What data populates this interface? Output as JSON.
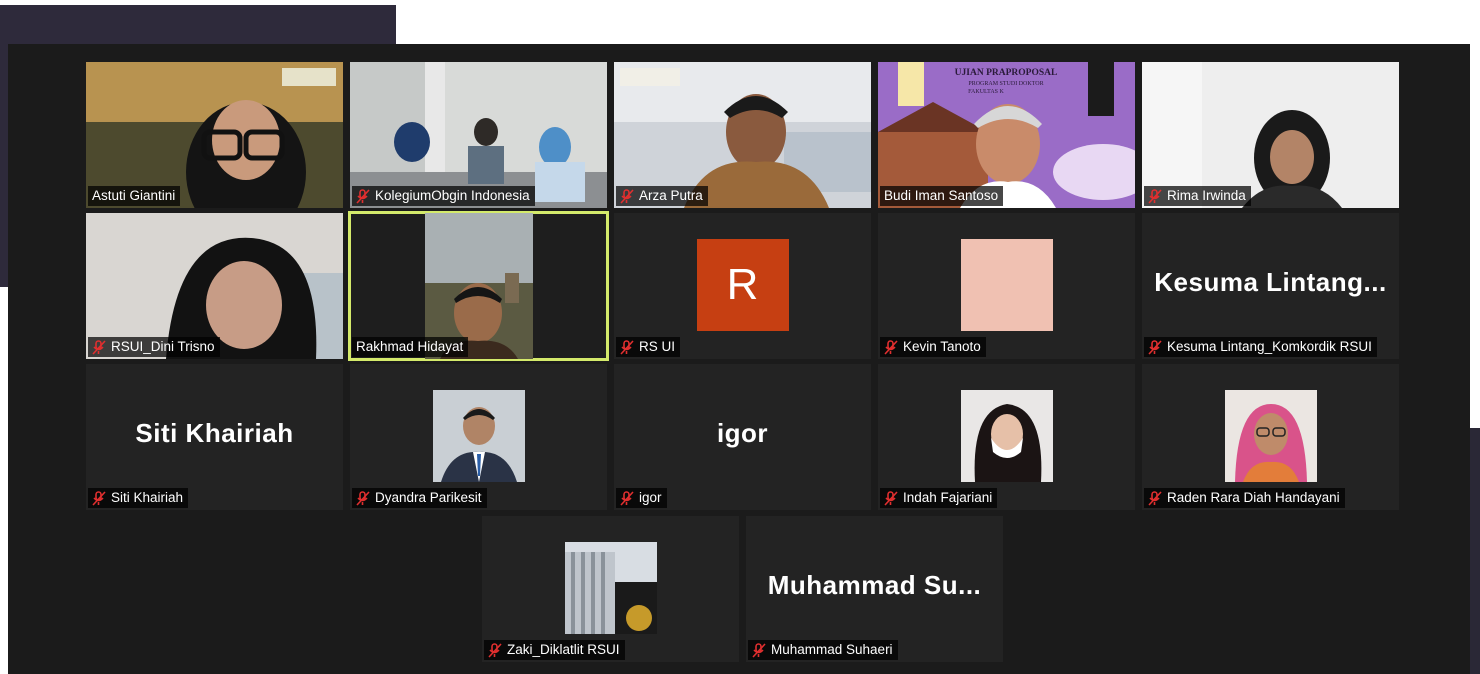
{
  "meeting": {
    "participants": [
      {
        "name": "Astuti Giantini",
        "muted": false,
        "type": "video"
      },
      {
        "name": "KolegiumObgin Indonesia",
        "muted": true,
        "type": "video"
      },
      {
        "name": "Arza Putra",
        "muted": true,
        "type": "video"
      },
      {
        "name": "Budi Iman Santoso",
        "muted": false,
        "type": "video"
      },
      {
        "name": "Rima Irwinda",
        "muted": true,
        "type": "video"
      },
      {
        "name": "RSUI_Dini Trisno",
        "muted": true,
        "type": "video"
      },
      {
        "name": "Rakhmad Hidayat",
        "muted": false,
        "type": "video",
        "active_speaker": true
      },
      {
        "name": "RS UI",
        "muted": true,
        "type": "avatar",
        "avatar_letter": "R"
      },
      {
        "name": "Kevin Tanoto",
        "muted": true,
        "type": "avatar"
      },
      {
        "name": "Kesuma Lintang_Komkordik RSUI",
        "muted": true,
        "type": "name",
        "display": "Kesuma  Lintang..."
      },
      {
        "name": "Siti Khairiah",
        "muted": true,
        "type": "name",
        "display": "Siti Khairiah"
      },
      {
        "name": "Dyandra Parikesit",
        "muted": true,
        "type": "photo"
      },
      {
        "name": "igor",
        "muted": true,
        "type": "name",
        "display": "igor"
      },
      {
        "name": "Indah Fajariani",
        "muted": true,
        "type": "photo"
      },
      {
        "name": "Raden Rara Diah Handayani",
        "muted": true,
        "type": "photo"
      },
      {
        "name": "Zaki_Diklatlit RSUI",
        "muted": true,
        "type": "photo"
      },
      {
        "name": "Muhammad Suhaeri",
        "muted": true,
        "type": "name",
        "display": "Muhammad  Su..."
      }
    ],
    "backgrounds": {
      "budi_title": "UJIAN PRAPROPOSAL",
      "budi_subtitle": "PROGRAM STUDI DOKTOR",
      "budi_subtitle2": "FAKULTAS K"
    }
  },
  "colors": {
    "active_border": "#d4ea6b",
    "mic_off": "#e02f2f",
    "avatar_r": "#c63f12"
  },
  "icons": {
    "muted": "mic-off-icon"
  }
}
